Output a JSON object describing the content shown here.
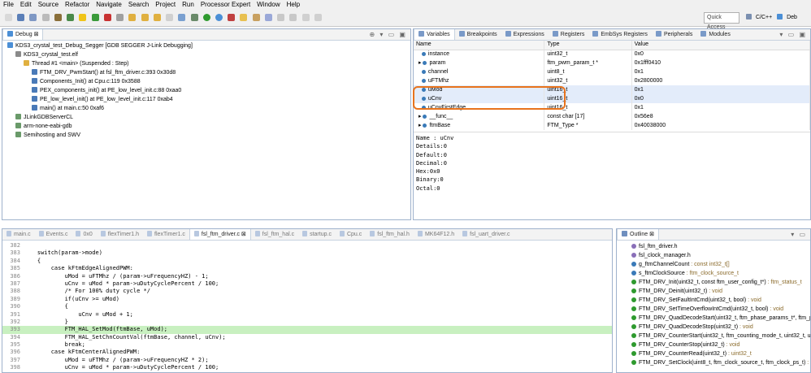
{
  "menu": [
    "File",
    "Edit",
    "Source",
    "Refactor",
    "Navigate",
    "Search",
    "Project",
    "Run",
    "Processor Expert",
    "Window",
    "Help"
  ],
  "toolbar": {
    "quick_access": "Quick Access",
    "perspective_1": "C/C++",
    "perspective_2": "Deb"
  },
  "debug": {
    "tab": "Debug",
    "items": [
      {
        "label": "KDS3_crystal_test_Debug_Segger [GDB SEGGER J-Link Debugging]",
        "indent": 0
      },
      {
        "label": "KDS3_crystal_test.elf",
        "indent": 1
      },
      {
        "label": "Thread #1 <main> (Suspended : Step)",
        "indent": 2
      },
      {
        "label": "FTM_DRV_PwmStart() at fsl_ftm_driver.c:393 0x30d8",
        "indent": 3
      },
      {
        "label": "Components_Init() at Cpu.c:119 0x3588",
        "indent": 3
      },
      {
        "label": "PEX_components_init() at PE_low_level_init.c:88 0xaa0",
        "indent": 3
      },
      {
        "label": "PE_low_level_init() at PE_low_level_init.c:117 0xab4",
        "indent": 3
      },
      {
        "label": "main() at main.c:50 0xaf6",
        "indent": 3
      },
      {
        "label": "JLinkGDBServerCL",
        "indent": 1
      },
      {
        "label": "arm-none-eabi-gdb",
        "indent": 1
      },
      {
        "label": "Semihosting and SWV",
        "indent": 1
      }
    ]
  },
  "variables": {
    "tabs": [
      "Variables",
      "Breakpoints",
      "Expressions",
      "Registers",
      "EmbSys Registers",
      "Peripherals",
      "Modules"
    ],
    "columns": [
      "Name",
      "Type",
      "Value"
    ],
    "rows": [
      {
        "name": "instance",
        "type": "uint32_t",
        "value": "0x0"
      },
      {
        "name": "param",
        "type": "ftm_pwm_param_t *",
        "value": "0x1fff0410"
      },
      {
        "name": "channel",
        "type": "uint8_t",
        "value": "0x1"
      },
      {
        "name": "uFTMhz",
        "type": "uint32_t",
        "value": "0x2800000"
      },
      {
        "name": "uMod",
        "type": "uint16_t",
        "value": "0x1"
      },
      {
        "name": "uCnv",
        "type": "uint16_t",
        "value": "0x0"
      },
      {
        "name": "uCnvFirstEdge",
        "type": "uint16_t",
        "value": "0x1"
      },
      {
        "name": "__func__",
        "type": "const char [17]",
        "value": "0x56e8"
      },
      {
        "name": "ftmBase",
        "type": "FTM_Type *",
        "value": "0x40038000"
      }
    ],
    "details": [
      "Name : uCnv",
      "Details:0",
      "Default:0",
      "Decimal:0",
      "Hex:0x0",
      "Binary:0",
      "Octal:0"
    ]
  },
  "editor": {
    "tabs": [
      "main.c",
      "Events.c",
      "0x0",
      "flexTimer1.h",
      "flexTimer1.c",
      "fsl_ftm_driver.c",
      "fsl_ftm_hal.c",
      "startup.c",
      "Cpu.c",
      "fsl_ftm_hal.h",
      "MK64F12.h",
      "fsl_uart_driver.c"
    ],
    "lines": [
      {
        "n": "382",
        "t": ""
      },
      {
        "n": "383",
        "t": "    switch(param->mode)"
      },
      {
        "n": "384",
        "t": "    {"
      },
      {
        "n": "385",
        "t": "        case kFtmEdgeAlignedPWM:"
      },
      {
        "n": "386",
        "t": "            uMod = uFTMhz / (param->uFrequencyHZ) - 1;"
      },
      {
        "n": "387",
        "t": "            uCnv = uMod * param->uDutyCyclePercent / 100;"
      },
      {
        "n": "388",
        "t": "            /* For 100% duty cycle */"
      },
      {
        "n": "389",
        "t": "            if(uCnv >= uMod)"
      },
      {
        "n": "390",
        "t": "            {"
      },
      {
        "n": "391",
        "t": "                uCnv = uMod + 1;"
      },
      {
        "n": "392",
        "t": "            }"
      },
      {
        "n": "393",
        "t": "            FTM_HAL_SetMod(ftmBase, uMod);"
      },
      {
        "n": "394",
        "t": "            FTM_HAL_SetChnCountVal(ftmBase, channel, uCnv);"
      },
      {
        "n": "395",
        "t": "            break;"
      },
      {
        "n": "396",
        "t": "        case kFtmCenterAlignedPWM:"
      },
      {
        "n": "397",
        "t": "            uMod = uFTMhz / (param->uFrequencyHZ * 2);"
      },
      {
        "n": "398",
        "t": "            uCnv = uMod * param->uDutyCyclePercent / 100;"
      }
    ]
  },
  "outline": {
    "tab": "Outline",
    "items": [
      {
        "label": "fsl_ftm_driver.h",
        "ret": ""
      },
      {
        "label": "fsl_clock_manager.h",
        "ret": ""
      },
      {
        "label": "g_ftmChannelCount",
        "ret": " : const int32_t[]"
      },
      {
        "label": "s_ftmClockSource",
        "ret": " : ftm_clock_source_t"
      },
      {
        "label": "FTM_DRV_Init(uint32_t, const ftm_user_config_t*)",
        "ret": " : ftm_status_t"
      },
      {
        "label": "FTM_DRV_Deinit(uint32_t)",
        "ret": " : void"
      },
      {
        "label": "FTM_DRV_SetFaultIntCmd(uint32_t, bool)",
        "ret": " : void"
      },
      {
        "label": "FTM_DRV_SetTimeOverflowIntCmd(uint32_t, bool)",
        "ret": " : void"
      },
      {
        "label": "FTM_DRV_QuadDecodeStart(uint32_t, ftm_phase_params_t*, ftm_phase_pa",
        "ret": ""
      },
      {
        "label": "FTM_DRV_QuadDecodeStop(uint32_t)",
        "ret": " : void"
      },
      {
        "label": "FTM_DRV_CounterStart(uint32_t, ftm_counting_mode_t, uint32_t, uint32_t",
        "ret": ""
      },
      {
        "label": "FTM_DRV_CounterStop(uint32_t)",
        "ret": " : void"
      },
      {
        "label": "FTM_DRV_CounterRead(uint32_t)",
        "ret": " : uint32_t"
      },
      {
        "label": "FTM_DRV_SetClock(uint8_t, ftm_clock_source_t, ftm_clock_ps_t)",
        "ret": " : void"
      }
    ]
  },
  "colors": {
    "accent": "#e8731c",
    "panel_border": "#9fb2cc",
    "highlight_line": "#c8f0c0"
  }
}
